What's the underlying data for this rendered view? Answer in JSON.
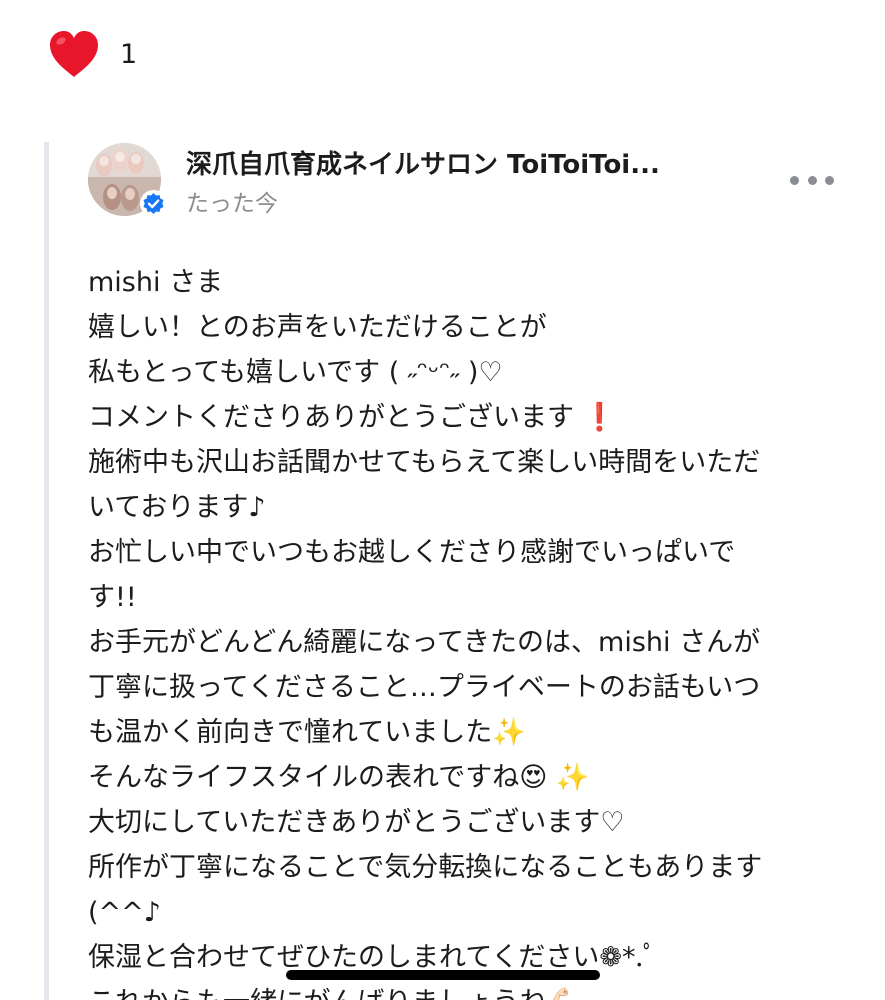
{
  "reaction": {
    "icon": "heart-icon",
    "count": "1",
    "color": "#e8162a"
  },
  "comment": {
    "author": "深爪自爪育成ネイルサロン ToiToiToi...",
    "timestamp": "たった今",
    "avatar_icon": "nail-photo-avatar",
    "verified_icon": "verified-badge-icon",
    "verified_color": "#1877f2",
    "more_icon": "more-options-icon",
    "lines": [
      "mishi さま",
      "嬉しい！とのお声をいただけることが",
      "私もとっても嬉しいです ( ˶ᵔᵕᵔ˶ )♡",
      "コメントくださりありがとうございます ❗️",
      "施術中も沢山お話聞かせてもらえて楽しい時間をいただ",
      "いております♪",
      "お忙しい中でいつもお越しくださり感謝でいっぱいで",
      "す!!",
      "お手元がどんどん綺麗になってきたのは、mishi さんが",
      "丁寧に扱ってくださること…プライベートのお話もいつ",
      "も温かく前向きで憧れていました✨",
      "そんなライフスタイルの表れですね😍 ✨",
      "大切にしていただきありがとうございます♡",
      "所作が丁寧になることで気分転換になることもあります",
      "(^^♪",
      "保湿と合わせてぜひたのしまれてください❁*.ﾟ",
      "これからも一緒にがんばりましょうね💪🏻"
    ]
  }
}
